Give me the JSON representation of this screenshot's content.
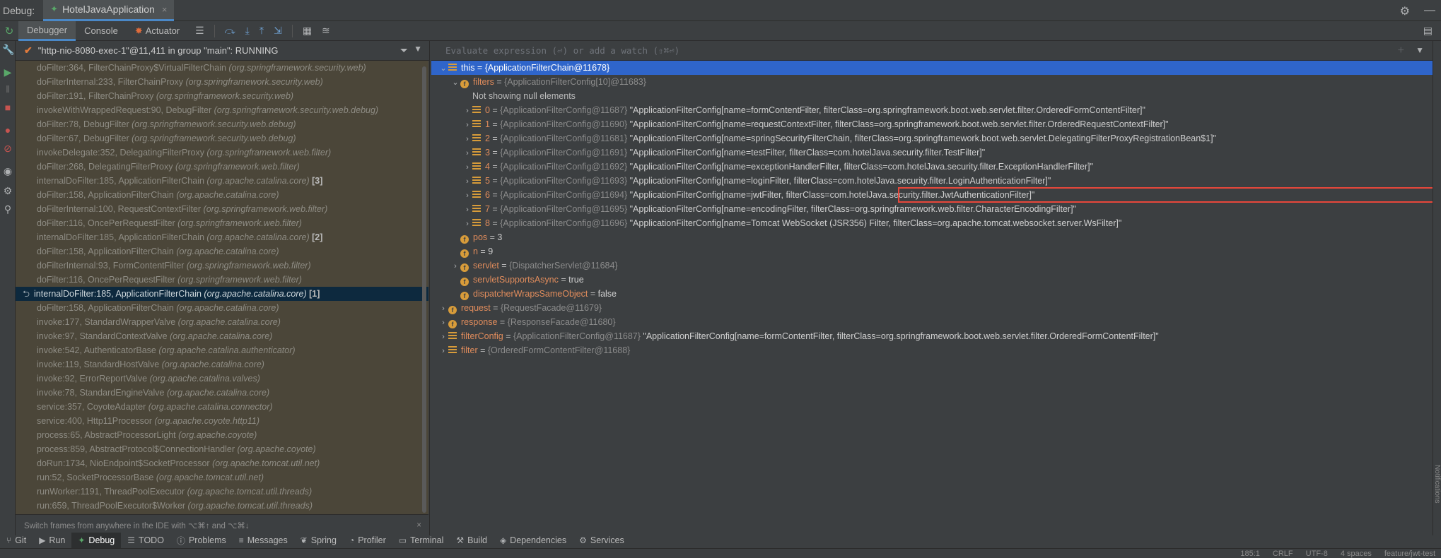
{
  "titlebar": {
    "label": "Debug:",
    "tab": "HotelJavaApplication"
  },
  "toolbar": {
    "tabs": [
      "Debugger",
      "Console",
      "Actuator"
    ]
  },
  "thread": {
    "name": "\"http-nio-8080-exec-1\"@11,411 in group \"main\": RUNNING"
  },
  "frames": [
    {
      "m": "doFilter:364, FilterChainProxy$VirtualFilterChain",
      "p": "(org.springframework.security.web)",
      "c": ""
    },
    {
      "m": "doFilterInternal:233, FilterChainProxy",
      "p": "(org.springframework.security.web)",
      "c": ""
    },
    {
      "m": "doFilter:191, FilterChainProxy",
      "p": "(org.springframework.security.web)",
      "c": ""
    },
    {
      "m": "invokeWithWrappedRequest:90, DebugFilter",
      "p": "(org.springframework.security.web.debug)",
      "c": ""
    },
    {
      "m": "doFilter:78, DebugFilter",
      "p": "(org.springframework.security.web.debug)",
      "c": ""
    },
    {
      "m": "doFilter:67, DebugFilter",
      "p": "(org.springframework.security.web.debug)",
      "c": ""
    },
    {
      "m": "invokeDelegate:352, DelegatingFilterProxy",
      "p": "(org.springframework.web.filter)",
      "c": ""
    },
    {
      "m": "doFilter:268, DelegatingFilterProxy",
      "p": "(org.springframework.web.filter)",
      "c": ""
    },
    {
      "m": "internalDoFilter:185, ApplicationFilterChain",
      "p": "(org.apache.catalina.core)",
      "c": "[3]"
    },
    {
      "m": "doFilter:158, ApplicationFilterChain",
      "p": "(org.apache.catalina.core)",
      "c": ""
    },
    {
      "m": "doFilterInternal:100, RequestContextFilter",
      "p": "(org.springframework.web.filter)",
      "c": ""
    },
    {
      "m": "doFilter:116, OncePerRequestFilter",
      "p": "(org.springframework.web.filter)",
      "c": ""
    },
    {
      "m": "internalDoFilter:185, ApplicationFilterChain",
      "p": "(org.apache.catalina.core)",
      "c": "[2]"
    },
    {
      "m": "doFilter:158, ApplicationFilterChain",
      "p": "(org.apache.catalina.core)",
      "c": ""
    },
    {
      "m": "doFilterInternal:93, FormContentFilter",
      "p": "(org.springframework.web.filter)",
      "c": ""
    },
    {
      "m": "doFilter:116, OncePerRequestFilter",
      "p": "(org.springframework.web.filter)",
      "c": ""
    },
    {
      "m": "internalDoFilter:185, ApplicationFilterChain",
      "p": "(org.apache.catalina.core)",
      "c": "[1]"
    },
    {
      "m": "doFilter:158, ApplicationFilterChain",
      "p": "(org.apache.catalina.core)",
      "c": ""
    },
    {
      "m": "invoke:177, StandardWrapperValve",
      "p": "(org.apache.catalina.core)",
      "c": ""
    },
    {
      "m": "invoke:97, StandardContextValve",
      "p": "(org.apache.catalina.core)",
      "c": ""
    },
    {
      "m": "invoke:542, AuthenticatorBase",
      "p": "(org.apache.catalina.authenticator)",
      "c": ""
    },
    {
      "m": "invoke:119, StandardHostValve",
      "p": "(org.apache.catalina.core)",
      "c": ""
    },
    {
      "m": "invoke:92, ErrorReportValve",
      "p": "(org.apache.catalina.valves)",
      "c": ""
    },
    {
      "m": "invoke:78, StandardEngineValve",
      "p": "(org.apache.catalina.core)",
      "c": ""
    },
    {
      "m": "service:357, CoyoteAdapter",
      "p": "(org.apache.catalina.connector)",
      "c": ""
    },
    {
      "m": "service:400, Http11Processor",
      "p": "(org.apache.coyote.http11)",
      "c": ""
    },
    {
      "m": "process:65, AbstractProcessorLight",
      "p": "(org.apache.coyote)",
      "c": ""
    },
    {
      "m": "process:859, AbstractProtocol$ConnectionHandler",
      "p": "(org.apache.coyote)",
      "c": ""
    },
    {
      "m": "doRun:1734, NioEndpoint$SocketProcessor",
      "p": "(org.apache.tomcat.util.net)",
      "c": ""
    },
    {
      "m": "run:52, SocketProcessorBase",
      "p": "(org.apache.tomcat.util.net)",
      "c": ""
    },
    {
      "m": "runWorker:1191, ThreadPoolExecutor",
      "p": "(org.apache.tomcat.util.threads)",
      "c": ""
    },
    {
      "m": "run:659, ThreadPoolExecutor$Worker",
      "p": "(org.apache.tomcat.util.threads)",
      "c": ""
    }
  ],
  "selected_frame_index": 16,
  "hint": "Switch frames from anywhere in the IDE with ⌥⌘↑ and ⌥⌘↓",
  "eval_placeholder": "Evaluate expression (⏎) or add a watch (⇧⌘⏎)",
  "variables": [
    {
      "lvl": 0,
      "arrow": "v",
      "icon": "lines",
      "name": "this",
      "type": "{ApplicationFilterChain@11678}",
      "val": "",
      "sel": true
    },
    {
      "lvl": 1,
      "arrow": "v",
      "icon": "field",
      "name": "filters",
      "type": "{ApplicationFilterConfig[10]@11683}",
      "val": ""
    },
    {
      "lvl": 2,
      "arrow": "",
      "icon": "",
      "name": "",
      "type": "",
      "val": "Not showing null elements"
    },
    {
      "lvl": 2,
      "arrow": ">",
      "icon": "lines",
      "name": "0",
      "type": "{ApplicationFilterConfig@11687}",
      "val": "\"ApplicationFilterConfig[name=formContentFilter, filterClass=org.springframework.boot.web.servlet.filter.OrderedFormContentFilter]\""
    },
    {
      "lvl": 2,
      "arrow": ">",
      "icon": "lines",
      "name": "1",
      "type": "{ApplicationFilterConfig@11690}",
      "val": "\"ApplicationFilterConfig[name=requestContextFilter, filterClass=org.springframework.boot.web.servlet.filter.OrderedRequestContextFilter]\""
    },
    {
      "lvl": 2,
      "arrow": ">",
      "icon": "lines",
      "name": "2",
      "type": "{ApplicationFilterConfig@11681}",
      "val": "\"ApplicationFilterConfig[name=springSecurityFilterChain, filterClass=org.springframework.boot.web.servlet.DelegatingFilterProxyRegistrationBean$1]\""
    },
    {
      "lvl": 2,
      "arrow": ">",
      "icon": "lines",
      "name": "3",
      "type": "{ApplicationFilterConfig@11691}",
      "val": "\"ApplicationFilterConfig[name=testFilter, filterClass=com.hotelJava.security.filter.TestFilter]\""
    },
    {
      "lvl": 2,
      "arrow": ">",
      "icon": "lines",
      "name": "4",
      "type": "{ApplicationFilterConfig@11692}",
      "val": "\"ApplicationFilterConfig[name=exceptionHandlerFilter, filterClass=com.hotelJava.security.filter.ExceptionHandlerFilter]\""
    },
    {
      "lvl": 2,
      "arrow": ">",
      "icon": "lines",
      "name": "5",
      "type": "{ApplicationFilterConfig@11693}",
      "val": "\"ApplicationFilterConfig[name=loginFilter, filterClass=com.hotelJava.security.filter.LoginAuthenticationFilter]\""
    },
    {
      "lvl": 2,
      "arrow": ">",
      "icon": "lines",
      "name": "6",
      "type": "{ApplicationFilterConfig@11694}",
      "val": "\"ApplicationFilterConfig[name=jwtFilter, filterClass=com.hotelJava.security.filter.JwtAuthenticationFilter]\""
    },
    {
      "lvl": 2,
      "arrow": ">",
      "icon": "lines",
      "name": "7",
      "type": "{ApplicationFilterConfig@11695}",
      "val": "\"ApplicationFilterConfig[name=encodingFilter, filterClass=org.springframework.web.filter.CharacterEncodingFilter]\""
    },
    {
      "lvl": 2,
      "arrow": ">",
      "icon": "lines",
      "name": "8",
      "type": "{ApplicationFilterConfig@11696}",
      "val": "\"ApplicationFilterConfig[name=Tomcat WebSocket (JSR356) Filter, filterClass=org.apache.tomcat.websocket.server.WsFilter]\""
    },
    {
      "lvl": 1,
      "arrow": "",
      "icon": "field",
      "name": "pos",
      "type": "",
      "val": "3"
    },
    {
      "lvl": 1,
      "arrow": "",
      "icon": "field",
      "name": "n",
      "type": "",
      "val": "9"
    },
    {
      "lvl": 1,
      "arrow": ">",
      "icon": "field",
      "name": "servlet",
      "type": "{DispatcherServlet@11684}",
      "val": ""
    },
    {
      "lvl": 1,
      "arrow": "",
      "icon": "field",
      "name": "servletSupportsAsync",
      "type": "",
      "val": "true"
    },
    {
      "lvl": 1,
      "arrow": "",
      "icon": "field",
      "name": "dispatcherWrapsSameObject",
      "type": "",
      "val": "false"
    },
    {
      "lvl": 0,
      "arrow": ">",
      "icon": "field",
      "name": "request",
      "type": "{RequestFacade@11679}",
      "val": ""
    },
    {
      "lvl": 0,
      "arrow": ">",
      "icon": "field",
      "name": "response",
      "type": "{ResponseFacade@11680}",
      "val": ""
    },
    {
      "lvl": 0,
      "arrow": ">",
      "icon": "lines",
      "name": "filterConfig",
      "type": "{ApplicationFilterConfig@11687}",
      "val": "\"ApplicationFilterConfig[name=formContentFilter, filterClass=org.springframework.boot.web.servlet.filter.OrderedFormContentFilter]\""
    },
    {
      "lvl": 0,
      "arrow": ">",
      "icon": "lines",
      "name": "filter",
      "type": "{OrderedFormContentFilter@11688}",
      "val": ""
    }
  ],
  "bottom_tabs": [
    {
      "icon": "git-icon",
      "label": "Git"
    },
    {
      "icon": "run-icon",
      "label": "Run"
    },
    {
      "icon": "debug-icon",
      "label": "Debug"
    },
    {
      "icon": "todo-icon",
      "label": "TODO"
    },
    {
      "icon": "problems-icon",
      "label": "Problems"
    },
    {
      "icon": "messages-icon",
      "label": "Messages"
    },
    {
      "icon": "spring-icon",
      "label": "Spring"
    },
    {
      "icon": "profiler-icon",
      "label": "Profiler"
    },
    {
      "icon": "terminal-icon",
      "label": "Terminal"
    },
    {
      "icon": "build-icon",
      "label": "Build"
    },
    {
      "icon": "dependencies-icon",
      "label": "Dependencies"
    },
    {
      "icon": "services-icon",
      "label": "Services"
    }
  ],
  "status": {
    "position": "185:1",
    "line_sep": "CRLF",
    "encoding": "UTF-8",
    "indent": "4 spaces",
    "branch": "feature/jwt-test"
  },
  "notifications": "Notifications",
  "colors": {
    "accent": "#4a88c7",
    "selection": "#2f65ca",
    "highlight_box": "#e8473b",
    "frames_bg": "#4b4639"
  }
}
